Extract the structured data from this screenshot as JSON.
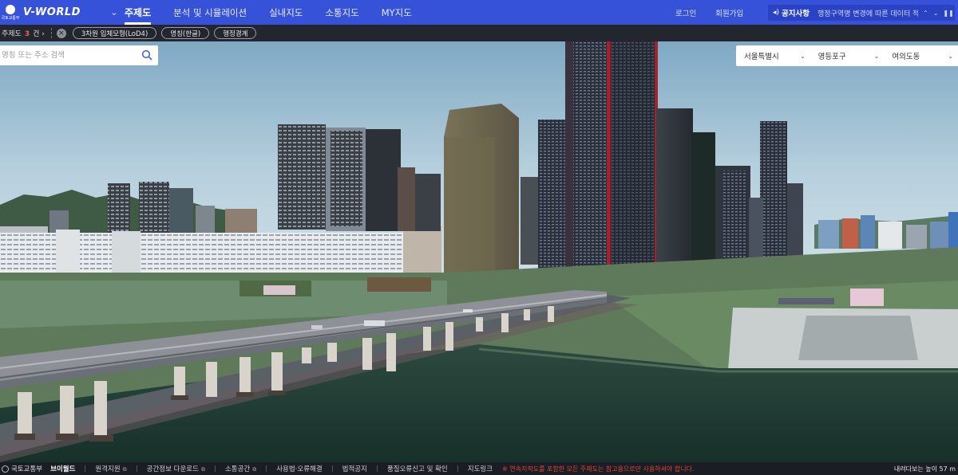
{
  "header": {
    "org_caption": "국토교통부",
    "brand": "V-WORLD",
    "menu": [
      {
        "label": "주제도",
        "active": true
      },
      {
        "label": "분석 및 시뮬레이션",
        "active": false
      },
      {
        "label": "실내지도",
        "active": false
      },
      {
        "label": "소통지도",
        "active": false
      },
      {
        "label": "MY지도",
        "active": false
      }
    ],
    "login": "로그인",
    "signup": "회원가입",
    "notice_label": "공지사항",
    "notice_text": "행정구역명 변경에 따른 데이터 적..."
  },
  "layer_strip": {
    "prefix": "주제도",
    "count": "3",
    "suffix": "건",
    "chips": [
      "3차원 입체모형(LoD4)",
      "명칭(한글)",
      "행정경계"
    ]
  },
  "search": {
    "placeholder": "명칭 또는 주소 검색"
  },
  "regions": {
    "sido": "서울특별시",
    "sigungu": "영등포구",
    "dong": "여의도동"
  },
  "footer": {
    "org": "국토교통부",
    "brand": "브이월드",
    "links": [
      "원격지원",
      "공간정보 다운로드",
      "소통공간",
      "사용법·오류해결",
      "법적공지",
      "품질오류신고 및 확인",
      "지도링크"
    ],
    "warning": "※ 연속지적도를 포함한 모든 주제도는 참고용으로만 사용하셔야 합니다.",
    "altitude": "내려다보는 높이 57 m"
  },
  "colors": {
    "nav": "#3552d9",
    "notice_bg": "#2a43c4",
    "strip": "#23262e",
    "count_red": "#ff5b4d",
    "warning_red": "#e0453a"
  }
}
